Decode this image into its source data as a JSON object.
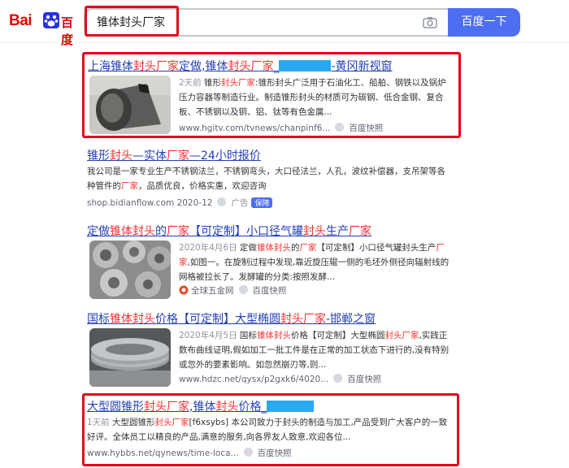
{
  "header": {
    "logo_bai": "Bai",
    "logo_du": "百度",
    "search_value": "锥体封头厂家",
    "search_button": "百度一下"
  },
  "results": [
    {
      "title_parts": [
        "上海",
        "锥体",
        "封头",
        "厂家",
        "定做,",
        "锥体",
        "封头",
        "厂家",
        "_"
      ],
      "title_suffix": "-黄冈新视窗",
      "date": "2天前",
      "desc": [
        " 锥形",
        "封头",
        "厂家",
        ":锥形封头广泛用于石油化工、船舶、钢铁以及锅炉压力容器等制造行业。制造锥形封头的材质可为碳钢、低合金钢、复合板、不锈钢以及铜、铝、钛等有色金属..."
      ],
      "url": "www.hgitv.com/tvnews/chanpinf6...",
      "snapshot": "百度快照"
    },
    {
      "title_parts": [
        "锥形",
        "封头",
        "—实体",
        "厂家",
        "—24小时报价"
      ],
      "desc": [
        "我公司是一家专业生产不锈钢法兰，不锈钢弯头，大口径法兰，人孔，波纹补偿器，支吊架等各种管件的",
        "厂家",
        "，品质优良，价格实惠，欢迎咨询"
      ],
      "url": "shop.bidianflow.com  2020-12",
      "ad_label": "广告",
      "tag": "保障"
    },
    {
      "title_parts": [
        "定做",
        "锥体",
        "封头",
        "的",
        "厂家",
        "【可定制】小口径气罐",
        "封头",
        "生产",
        "厂家"
      ],
      "date": "2020年4月6日",
      "desc": [
        " 定做",
        "锥体",
        "封头",
        "的",
        "厂家",
        "【可定制】小口径气罐封头生产",
        "厂家",
        ",如图一。在旋制过程中发现,靠近旋压辊一侧的毛坯外侧径向辐射线的网格被拉长了。发酵罐的分类:按照发酵..."
      ],
      "url": "全球五金网",
      "snapshot": "百度快照"
    },
    {
      "title_parts": [
        "国标",
        "锥体",
        "封头",
        "价格【可定制】大型椭圆",
        "封头",
        "厂家",
        "-邯郸之窗"
      ],
      "date": "2020年4月5日",
      "desc": [
        " 国标",
        "锥体",
        "封头",
        "价格【可定制】大型椭圆",
        "封头厂家",
        ",实践正数布曲线证明,假如加工一批工件是在正常的加工状态下进行的,没有特别或忽外的要素影响。如忽然崩刃等,则..."
      ],
      "url": "www.hdzc.net/qysx/p2gxk6/4020...",
      "snapshot": "百度快照"
    },
    {
      "title_parts": [
        "大型圆锥形",
        "封头",
        "厂家",
        ",锥体",
        "封头",
        "价格_"
      ],
      "date": "1天前",
      "desc": [
        " 大型圆锥形",
        "封头",
        "厂家",
        "[f6xsybs] 本公司致力于封头的制造与加工,产品受到广大客户的一致好评。全体员工以精良的产品,满意的服务,向各界友人致意,欢迎各位..."
      ],
      "url": "www.hybbs.net/qynews/time-loca...",
      "snapshot": "百度快照"
    }
  ]
}
